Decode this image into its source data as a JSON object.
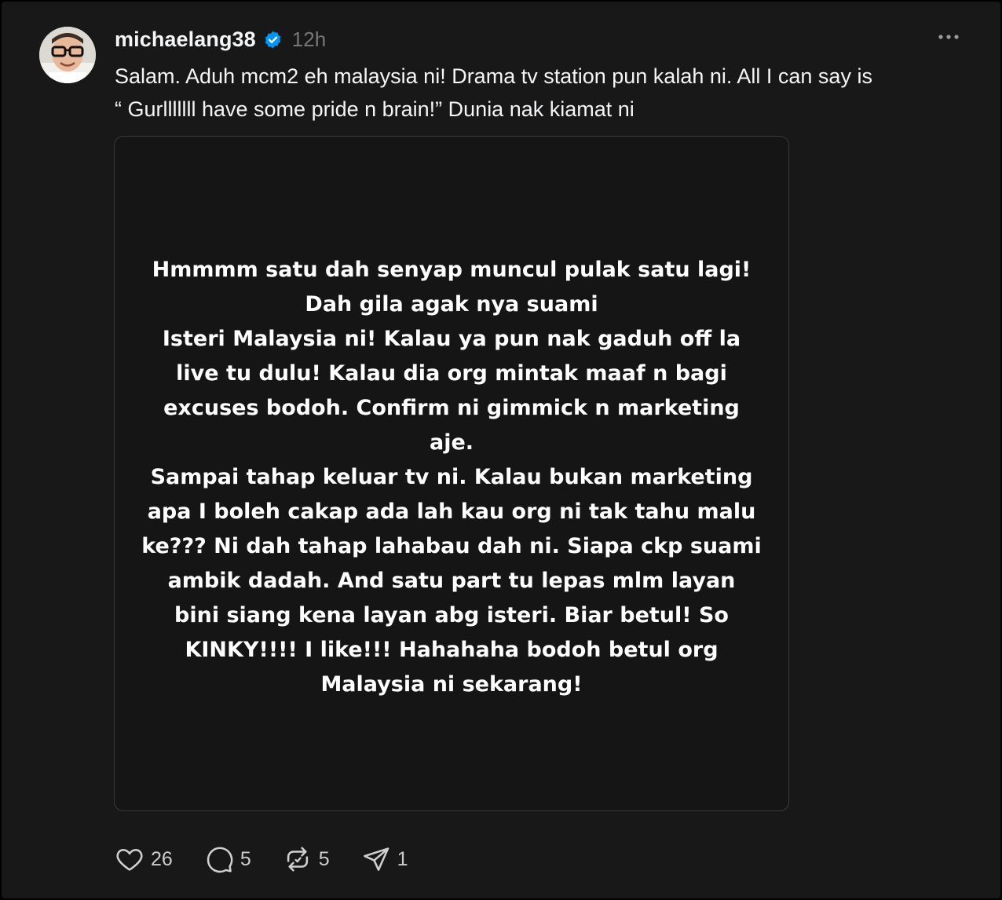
{
  "post": {
    "username": "michaelang38",
    "verified_icon": "verified-badge-icon",
    "time": "12h",
    "caption": "Salam. Aduh mcm2 eh malaysia ni! Drama tv station pun kalah ni. All I can say is\n“ Gurlllllll have some pride n brain!” Dunia nak kiamat ni",
    "image_text": "Hmmmm satu dah senyap muncul pulak satu lagi!\nDah gila agak nya suami\nIsteri Malaysia ni! Kalau ya pun nak gaduh off la\nlive tu dulu! Kalau dia org mintak maaf n bagi\nexcuses bodoh. Confirm ni gimmick n marketing aje.\nSampai tahap keluar tv ni. Kalau bukan marketing\napa I boleh cakap ada lah kau org ni tak tahu malu\nke??? Ni dah tahap lahabau dah ni. Siapa ckp suami\nambik dadah. And satu part tu lepas mlm layan\nbini siang kena layan abg isteri. Biar betul! So\nKINKY!!!! I like!!! Hahahaha bodoh betul org\nMalaysia ni sekarang!"
  },
  "actions": {
    "like_count": "26",
    "reply_count": "5",
    "repost_count": "5",
    "share_count": "1"
  },
  "colors": {
    "background": "#181818",
    "text": "#f3f5f7",
    "muted": "#777777",
    "verified": "#0095f6"
  }
}
